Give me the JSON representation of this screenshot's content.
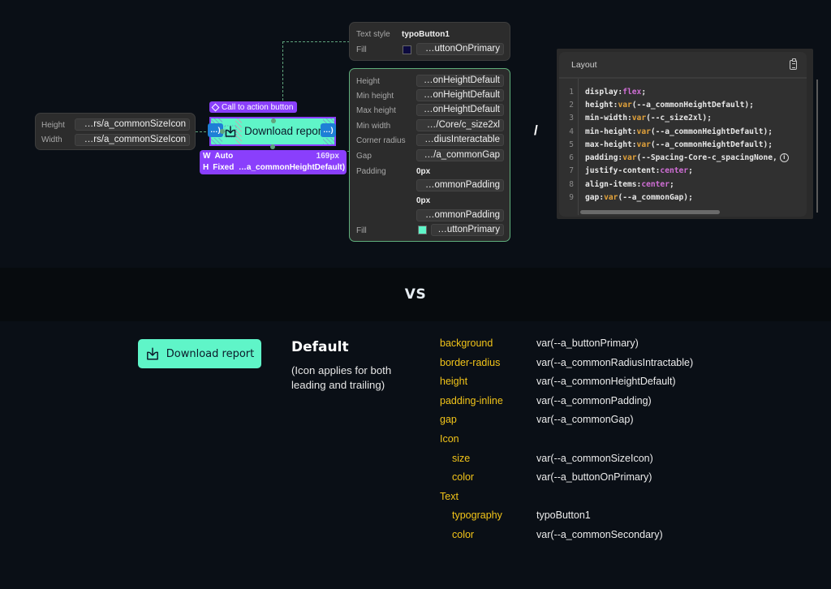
{
  "inspector": {
    "size_panel": {
      "rows": [
        {
          "label": "Height",
          "value": "…rs/a_commonSizeIcon"
        },
        {
          "label": "Width",
          "value": "…rs/a_commonSizeIcon"
        }
      ]
    },
    "typography_panel": {
      "text_style_label": "Text style",
      "text_style_value": "typoButton1",
      "fill_label": "Fill",
      "fill_color": "#0c0a3e",
      "fill_value": "…uttonOnPrimary"
    },
    "layout_panel": {
      "rows": [
        {
          "label": "Height",
          "value": "…onHeightDefault"
        },
        {
          "label": "Min height",
          "value": "…onHeightDefault"
        },
        {
          "label": "Max height",
          "value": "…onHeightDefault"
        },
        {
          "label": "Min width",
          "value": "…/Core/c_size2xl"
        },
        {
          "label": "Corner radius",
          "value": "…diusInteractable"
        },
        {
          "label": "Gap",
          "value": "…/a_commonGap"
        }
      ],
      "padding_label": "Padding",
      "padding": [
        {
          "px": "0px",
          "token": "…ommonPadding"
        },
        {
          "px": "0px",
          "token": "…ommonPadding"
        }
      ],
      "fill_label": "Fill",
      "fill_color": "#5ff5c8",
      "fill_value": "…uttonPrimary"
    }
  },
  "component": {
    "tag_label": "Call to action button",
    "button_label": "Download report",
    "padding_chip_left": "…)",
    "padding_chip_right": "…)",
    "width_key": "W",
    "width_value": "Auto",
    "width_px": "169px",
    "height_key": "H",
    "height_value": "Fixed  …a_commonHeightDefault)"
  },
  "separator": "/",
  "code_panel": {
    "title": "Layout",
    "lines": [
      {
        "n": "1",
        "prop": "display: ",
        "kw": "flex",
        "fn": "",
        "arg": "",
        "end": ";"
      },
      {
        "n": "2",
        "prop": "height: ",
        "kw": "",
        "fn": "var",
        "arg": "(--a_commonHeightDefault)",
        "end": ";"
      },
      {
        "n": "3",
        "prop": "min-width: ",
        "kw": "",
        "fn": "var",
        "arg": "(--c_size2xl)",
        "end": ";"
      },
      {
        "n": "4",
        "prop": "min-height: ",
        "kw": "",
        "fn": "var",
        "arg": "(--a_commonHeightDefault)",
        "end": ";"
      },
      {
        "n": "5",
        "prop": "max-height: ",
        "kw": "",
        "fn": "var",
        "arg": "(--a_commonHeightDefault)",
        "end": ";"
      },
      {
        "n": "6",
        "prop": "padding: ",
        "kw": "",
        "fn": "var",
        "arg": "(--Spacing-Core-c_spacingNone,",
        "end": ""
      },
      {
        "n": "7",
        "prop": "justify-content: ",
        "kw": "center",
        "fn": "",
        "arg": "",
        "end": ";"
      },
      {
        "n": "8",
        "prop": "align-items: ",
        "kw": "center",
        "fn": "",
        "arg": "",
        "end": ";"
      },
      {
        "n": "9",
        "prop": "gap: ",
        "kw": "",
        "fn": "var",
        "arg": "(--a_commonGap)",
        "end": ";"
      }
    ]
  },
  "vs_label": "VS",
  "spec": {
    "button_label": "Download report",
    "title": "Default",
    "note": "(Icon applies for both leading and trailing)",
    "rows": [
      {
        "key": "background",
        "value": "var(--a_buttonPrimary)",
        "indent": false
      },
      {
        "key": "border-radius",
        "value": "var(--a_commonRadiusIntractable)",
        "indent": false
      },
      {
        "key": "height",
        "value": "var(--a_commonHeightDefault)",
        "indent": false
      },
      {
        "key": "padding-inline",
        "value": "var(--a_commonPadding)",
        "indent": false
      },
      {
        "key": "gap",
        "value": "var(--a_commonGap)",
        "indent": false
      },
      {
        "key": "Icon",
        "value": "",
        "indent": false
      },
      {
        "key": "size",
        "value": "var(--a_commonSizeIcon)",
        "indent": true
      },
      {
        "key": "color",
        "value": "var(--a_buttonOnPrimary)",
        "indent": true
      },
      {
        "key": "Text",
        "value": "",
        "indent": false
      },
      {
        "key": "typography",
        "value": "typoButton1",
        "indent": true
      },
      {
        "key": "color",
        "value": "var(--a_commonSecondary)",
        "indent": true
      }
    ]
  },
  "colors": {
    "accent_purple": "#8a3ffc",
    "button_primary": "#5ff5c8",
    "spec_key": "#f2c419",
    "connector_green": "#5fa47c"
  }
}
